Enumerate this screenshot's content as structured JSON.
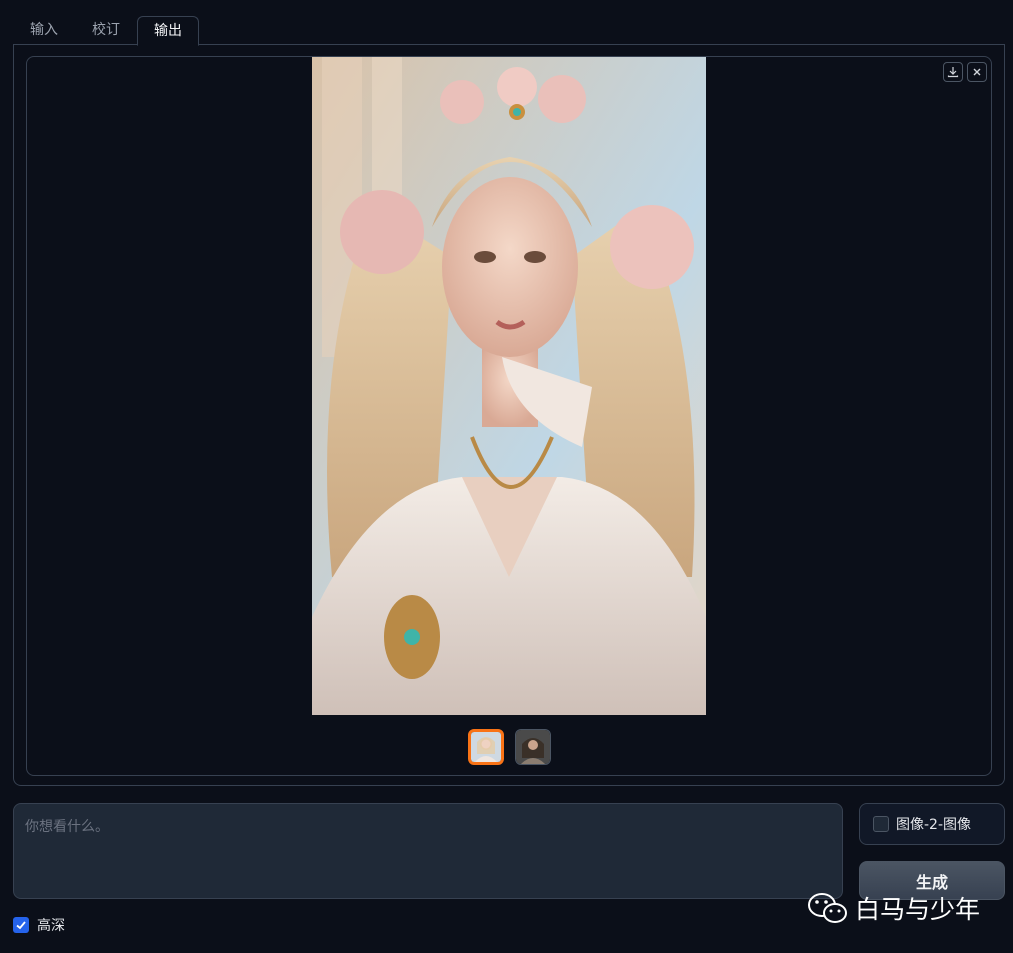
{
  "tabs": [
    {
      "label": "输入"
    },
    {
      "label": "校订"
    },
    {
      "label": "输出",
      "active": true
    }
  ],
  "gallery": {
    "download_icon": "download-icon",
    "close_icon": "close-icon",
    "main_image": "portrait of a blonde woman with pink flower crown and white dress",
    "thumbnails": [
      {
        "name": "thumbnail-1",
        "selected": true
      },
      {
        "name": "thumbnail-2",
        "selected": false
      }
    ]
  },
  "prompt": {
    "placeholder": "你想看什么。",
    "value": ""
  },
  "options": {
    "img2img_label": "图像-2-图像",
    "img2img_checked": false,
    "hd_label": "高深",
    "hd_checked": true
  },
  "generate_label": "生成",
  "watermark": {
    "text": "白马与少年",
    "icon": "wechat-icon"
  },
  "colors": {
    "background": "#0b0f19",
    "border": "#374151",
    "accent_selected": "#f97316",
    "checkbox_checked": "#2563eb"
  }
}
